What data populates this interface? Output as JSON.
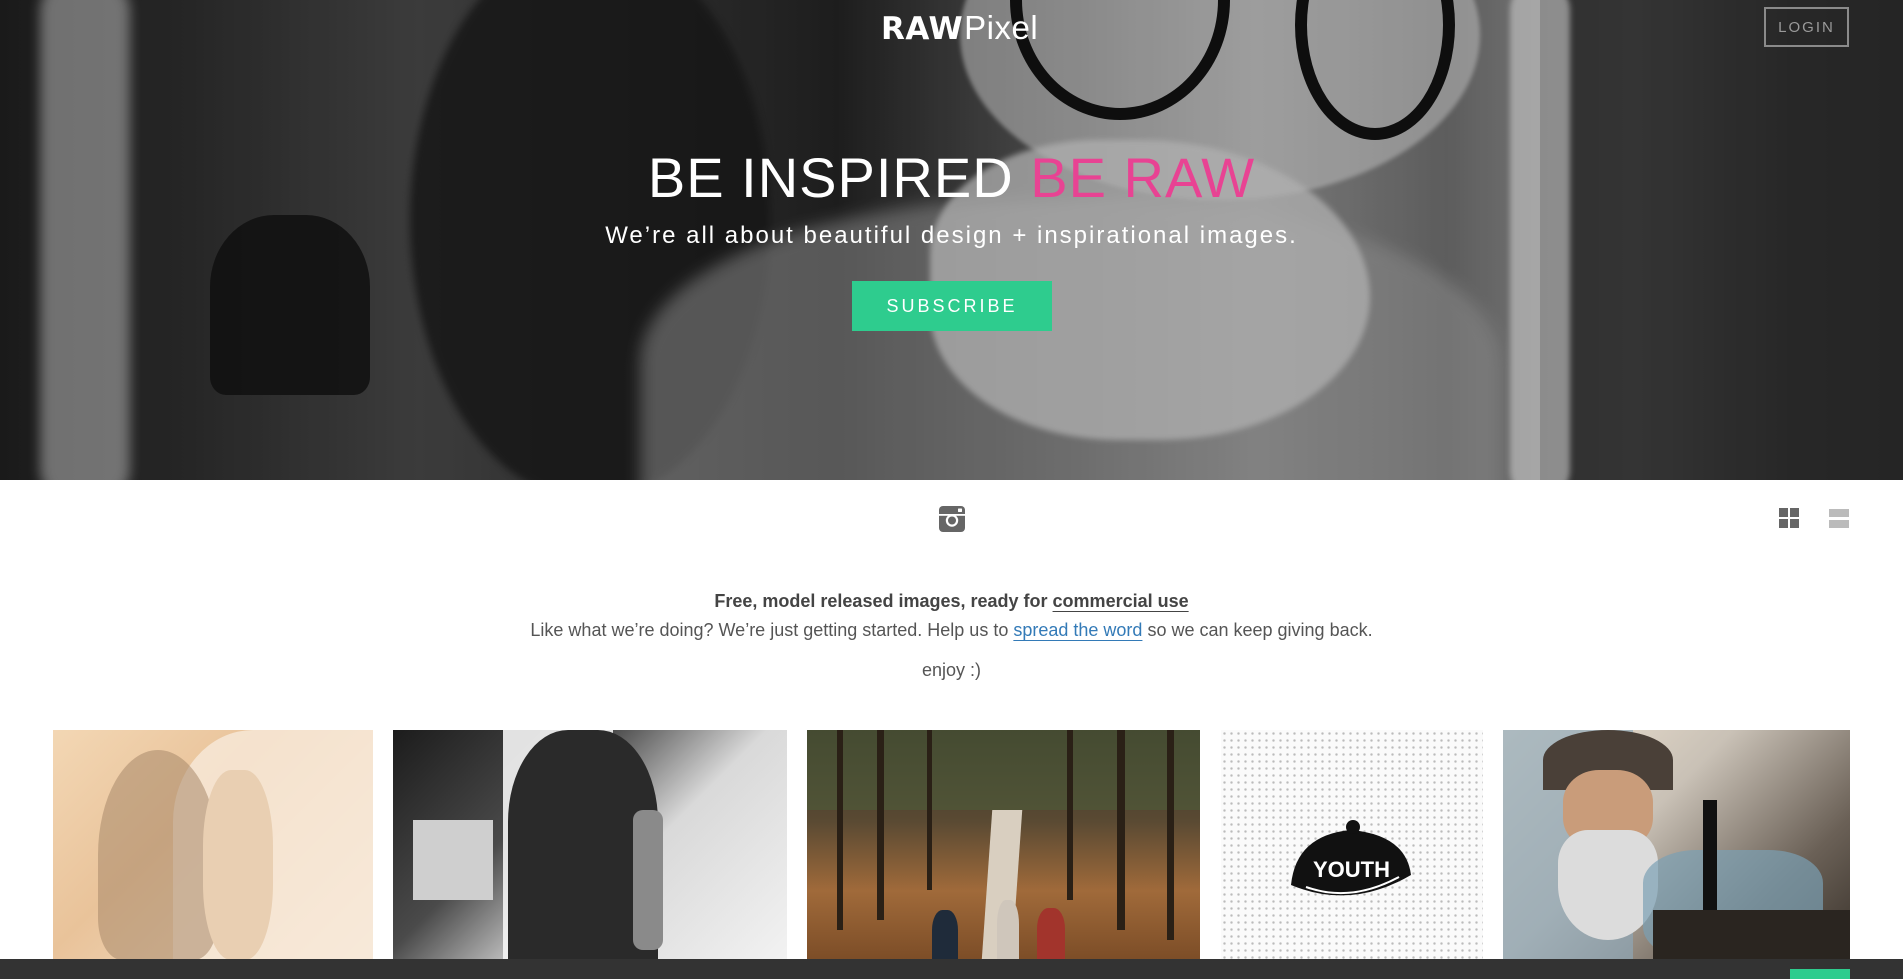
{
  "header": {
    "logo_raw": "RAW",
    "logo_pixel": "Pixel",
    "login_label": "LOGIN"
  },
  "hero": {
    "title_white": "BE INSPIRED",
    "title_accent": "BE RAW",
    "subtitle": "We’re all about beautiful design + inspirational images.",
    "subscribe_label": "SUBSCRIBE"
  },
  "toolbar": {
    "social_icon": "instagram-icon",
    "view_grid_icon": "grid-view-icon",
    "view_list_icon": "list-view-icon"
  },
  "intro": {
    "line1_bold": "Free, model released images, ready for",
    "line1_link": "commercial use",
    "line2_before": "Like what we’re doing? We’re just getting started. Help us to",
    "line2_link": "spread the word",
    "line2_after": "so we can keep giving back.",
    "line3": "enjoy :)"
  },
  "colors": {
    "accent_pink": "#e84393",
    "accent_green": "#2ecc8e",
    "link_blue": "#337ab7"
  }
}
